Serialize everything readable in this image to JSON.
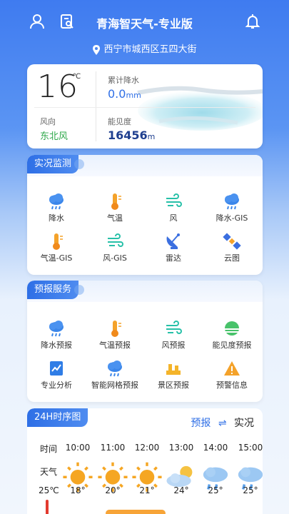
{
  "header": {
    "title": "青海智天气-专业版",
    "location": "西宁市城西区五四大街",
    "icons": [
      "user-icon",
      "document-search-icon",
      "bell-icon"
    ]
  },
  "current": {
    "temperature": "16",
    "temp_unit": "℃",
    "rain_label": "累计降水",
    "rain_value": "0.0",
    "rain_unit": "mm",
    "wind_label": "风向",
    "wind_value": "东北风",
    "vis_label": "能见度",
    "vis_value": "16456",
    "vis_unit": "m"
  },
  "monitoring": {
    "title": "实况监测",
    "items": [
      {
        "label": "降水",
        "icon": "rain-cloud-icon"
      },
      {
        "label": "气温",
        "icon": "thermometer-icon"
      },
      {
        "label": "风",
        "icon": "wind-icon"
      },
      {
        "label": "降水-GIS",
        "icon": "rain-cloud-icon"
      },
      {
        "label": "气温-GIS",
        "icon": "thermometer-icon"
      },
      {
        "label": "风-GIS",
        "icon": "wind-icon"
      },
      {
        "label": "雷达",
        "icon": "radar-icon"
      },
      {
        "label": "云图",
        "icon": "satellite-icon"
      }
    ]
  },
  "forecast": {
    "title": "预报服务",
    "items": [
      {
        "label": "降水预报",
        "icon": "rain-cloud-icon"
      },
      {
        "label": "气温预报",
        "icon": "thermometer-icon"
      },
      {
        "label": "风预报",
        "icon": "wind-icon"
      },
      {
        "label": "能见度预报",
        "icon": "visibility-icon"
      },
      {
        "label": "专业分析",
        "icon": "analysis-icon"
      },
      {
        "label": "智能网格预报",
        "icon": "rain-cloud-icon"
      },
      {
        "label": "景区预报",
        "icon": "scenic-icon"
      },
      {
        "label": "预警信息",
        "icon": "warning-icon"
      }
    ]
  },
  "timeline": {
    "title": "24H时序图",
    "mode_a": "预报",
    "mode_b": "实况",
    "time_label": "时间",
    "weather_label": "天气",
    "now_temp": "25℃",
    "hours": [
      {
        "time": "10:00",
        "temp": "18°",
        "icon": "sun-icon"
      },
      {
        "time": "11:00",
        "temp": "20°",
        "icon": "sun-icon"
      },
      {
        "time": "12:00",
        "temp": "21°",
        "icon": "sun-icon"
      },
      {
        "time": "13:00",
        "temp": "24°",
        "icon": "partly-cloudy-icon"
      },
      {
        "time": "14:00",
        "temp": "25°",
        "icon": "light-rain-icon"
      },
      {
        "time": "15:00",
        "temp": "25°",
        "icon": "light-rain-icon"
      }
    ]
  }
}
